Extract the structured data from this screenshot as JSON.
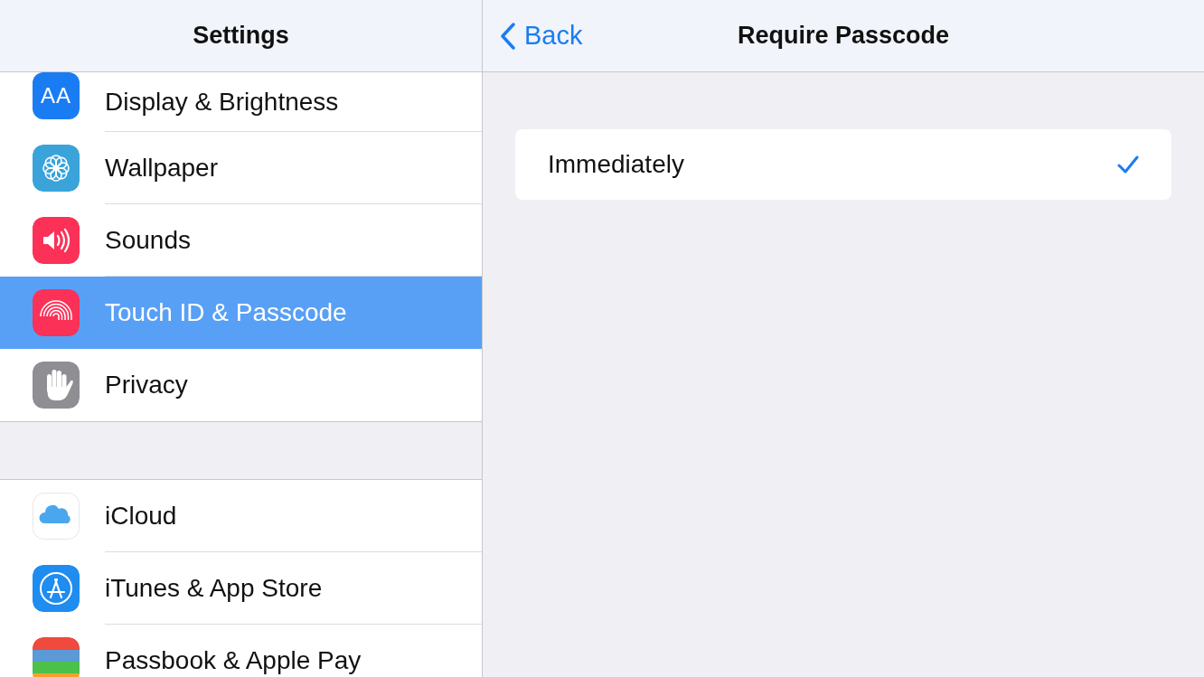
{
  "sidebar": {
    "title": "Settings",
    "groups": [
      {
        "items": [
          {
            "label": "Display & Brightness",
            "kind": "display",
            "glyph": "AA",
            "selected": false
          },
          {
            "label": "Wallpaper",
            "kind": "wallpaper",
            "selected": false
          },
          {
            "label": "Sounds",
            "kind": "sounds",
            "selected": false
          },
          {
            "label": "Touch ID & Passcode",
            "kind": "touchid",
            "selected": true
          },
          {
            "label": "Privacy",
            "kind": "privacy",
            "selected": false
          }
        ]
      },
      {
        "items": [
          {
            "label": "iCloud",
            "kind": "icloud",
            "selected": false
          },
          {
            "label": "iTunes & App Store",
            "kind": "appstore",
            "selected": false
          },
          {
            "label": "Passbook & Apple Pay",
            "kind": "passbook",
            "selected": false
          }
        ]
      }
    ]
  },
  "detail": {
    "back": "Back",
    "title": "Require Passcode",
    "options": [
      {
        "label": "Immediately",
        "selected": true
      }
    ]
  }
}
